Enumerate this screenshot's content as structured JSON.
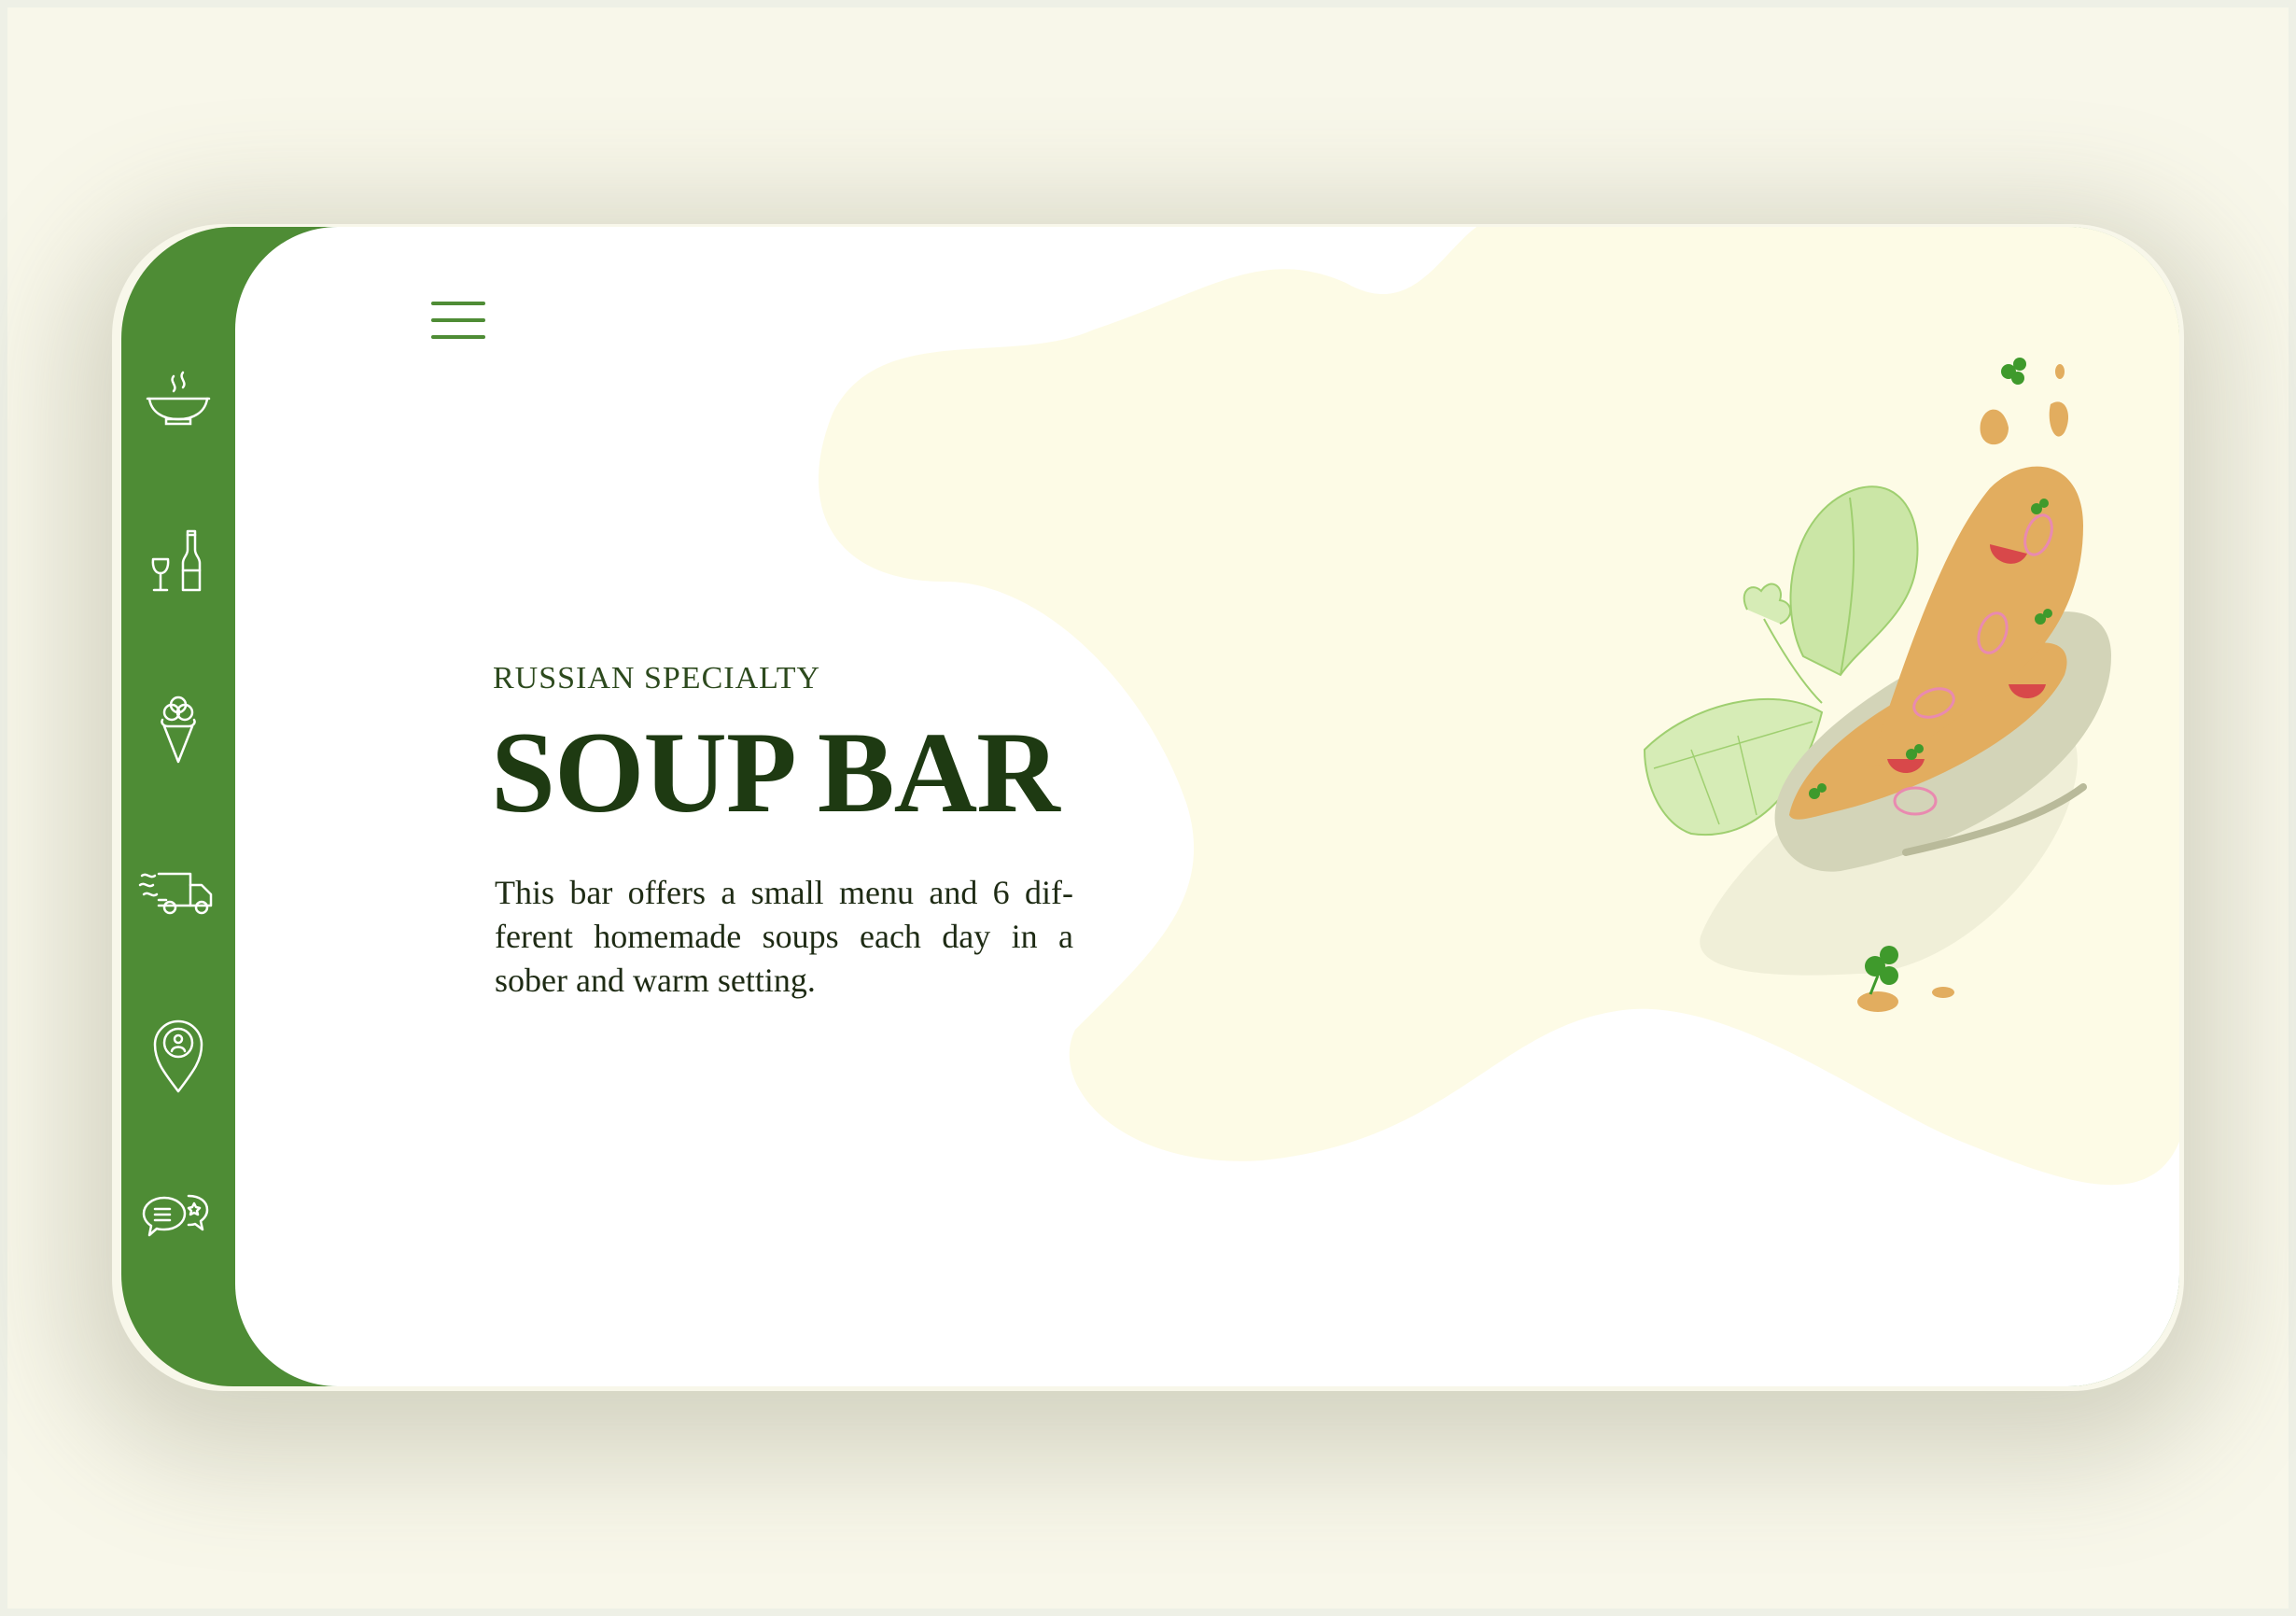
{
  "sidebar": {
    "items": [
      {
        "icon": "soup-bowl-icon"
      },
      {
        "icon": "wine-icon"
      },
      {
        "icon": "ice-cream-icon"
      },
      {
        "icon": "delivery-truck-icon"
      },
      {
        "icon": "location-pin-icon"
      },
      {
        "icon": "reviews-chat-icon"
      }
    ]
  },
  "header": {
    "menu_icon": "hamburger-menu-icon"
  },
  "hero": {
    "eyebrow": "RUSSIAN SPECIALTY",
    "title": "SOUP BAR",
    "description": "This bar offers a small menu and 6 dif-ferent homemade soups each day in a sober and warm setting."
  },
  "colors": {
    "brand_green": "#4e8c35",
    "title_green": "#1e3a12",
    "blob_cream": "#fdfbe6",
    "soup_orange": "#e2ad5f"
  }
}
